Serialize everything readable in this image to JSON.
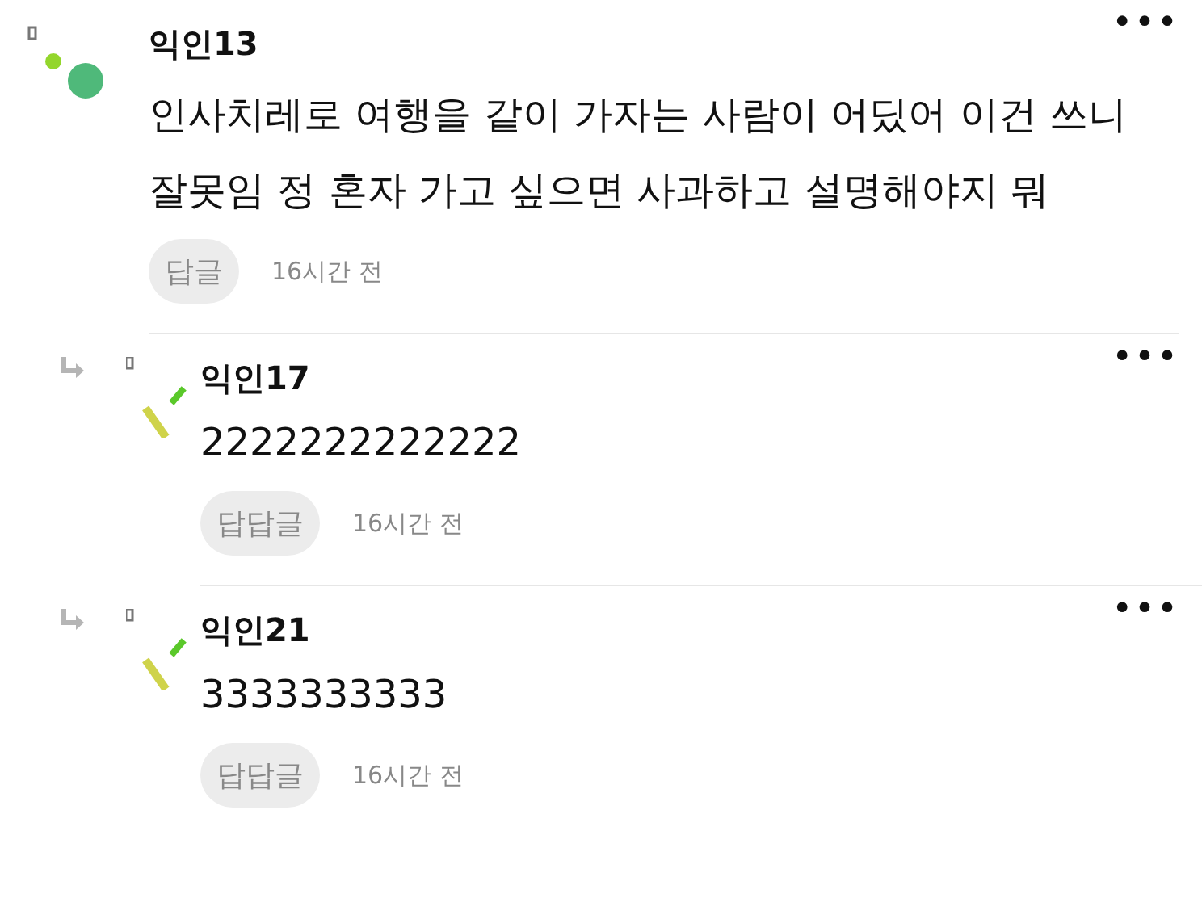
{
  "comments": [
    {
      "kind": "comment",
      "author": "익인13",
      "text": "인사치레로 여행을 같이 가자는 사람이 어딨어 이건 쓰니 잘못임 정 혼자 가고 싶으면 사과하고 설명해야지 뭐",
      "reply_button": "답글",
      "time": "16시간 전",
      "more": "•••"
    },
    {
      "kind": "reply",
      "author": "익인17",
      "text": "2222222222222",
      "reply_button": "답답글",
      "time": "16시간 전",
      "more": "•••"
    },
    {
      "kind": "reply",
      "author": "익인21",
      "text": "3333333333",
      "reply_button": "답답글",
      "time": "16시간 전",
      "more": "•••"
    }
  ]
}
